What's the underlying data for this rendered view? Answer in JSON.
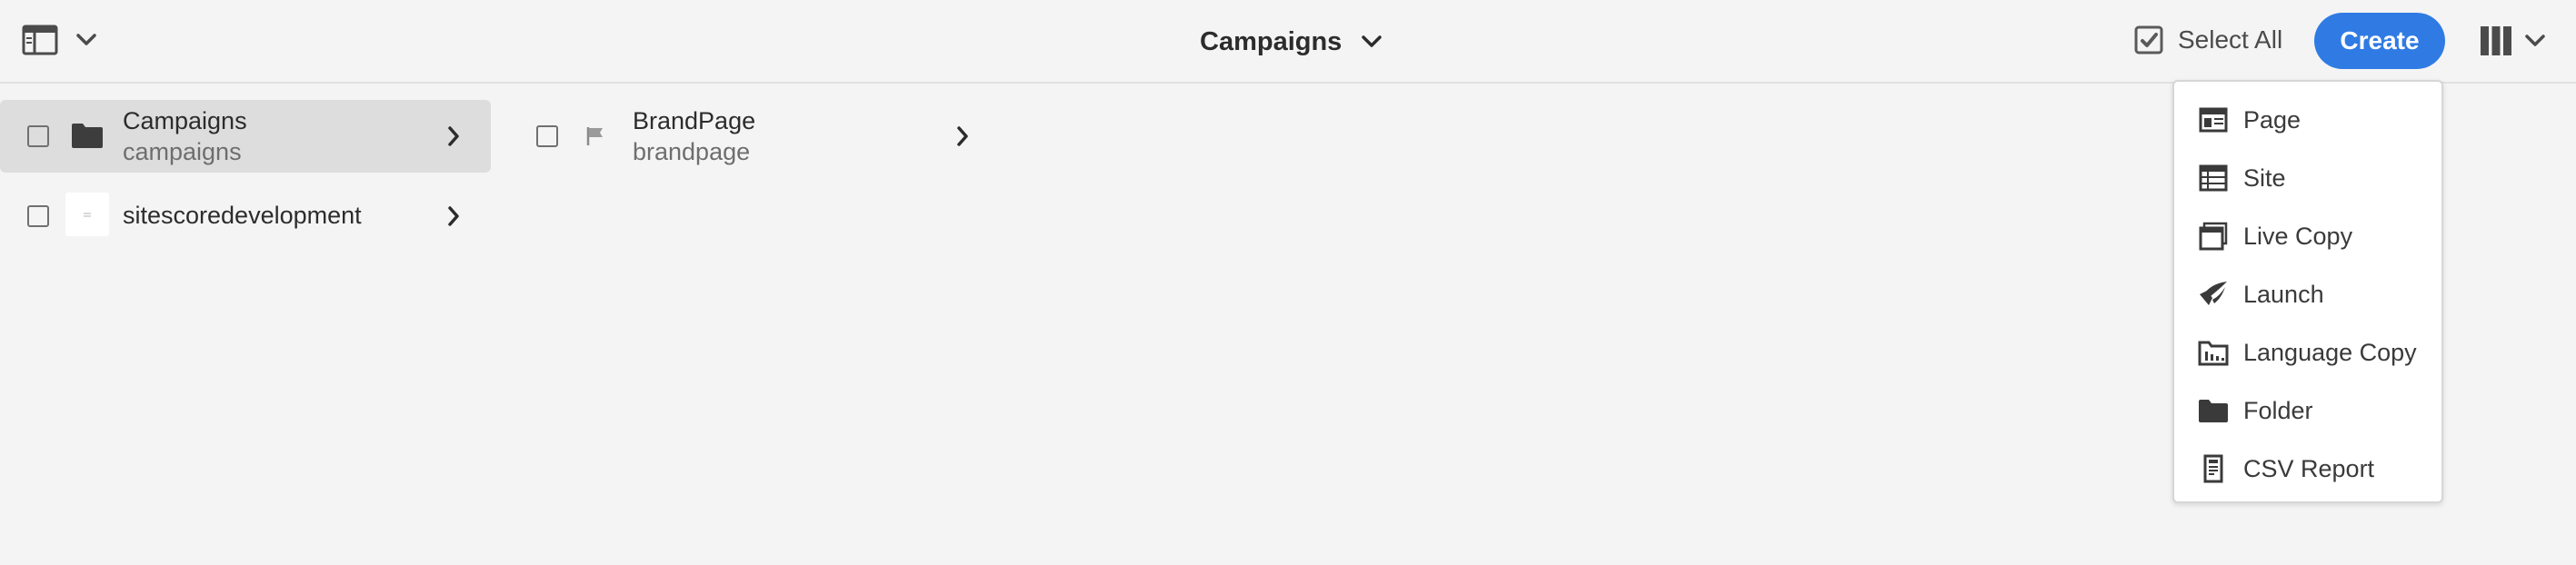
{
  "header": {
    "title": "Campaigns",
    "select_all_label": "Select All",
    "create_label": "Create"
  },
  "columns": [
    {
      "rows": [
        {
          "title": "Campaigns",
          "subtitle": "campaigns",
          "selected": true,
          "icon": "folder-icon"
        },
        {
          "title": "sitescoredevelopment",
          "subtitle": "",
          "selected": false,
          "icon": "page-thumbnail"
        }
      ]
    },
    {
      "rows": [
        {
          "title": "BrandPage",
          "subtitle": "brandpage",
          "selected": false,
          "icon": "flag-icon"
        }
      ]
    }
  ],
  "create_menu": {
    "items": [
      {
        "label": "Page",
        "icon": "page-icon"
      },
      {
        "label": "Site",
        "icon": "site-icon"
      },
      {
        "label": "Live Copy",
        "icon": "live-copy-icon"
      },
      {
        "label": "Launch",
        "icon": "launch-icon"
      },
      {
        "label": "Language Copy",
        "icon": "language-copy-icon"
      },
      {
        "label": "Folder",
        "icon": "folder-icon"
      },
      {
        "label": "CSV Report",
        "icon": "csv-report-icon"
      }
    ]
  },
  "colors": {
    "accent": "#2f7be3",
    "background": "#f4f4f4",
    "selected_row": "#dddddd"
  }
}
